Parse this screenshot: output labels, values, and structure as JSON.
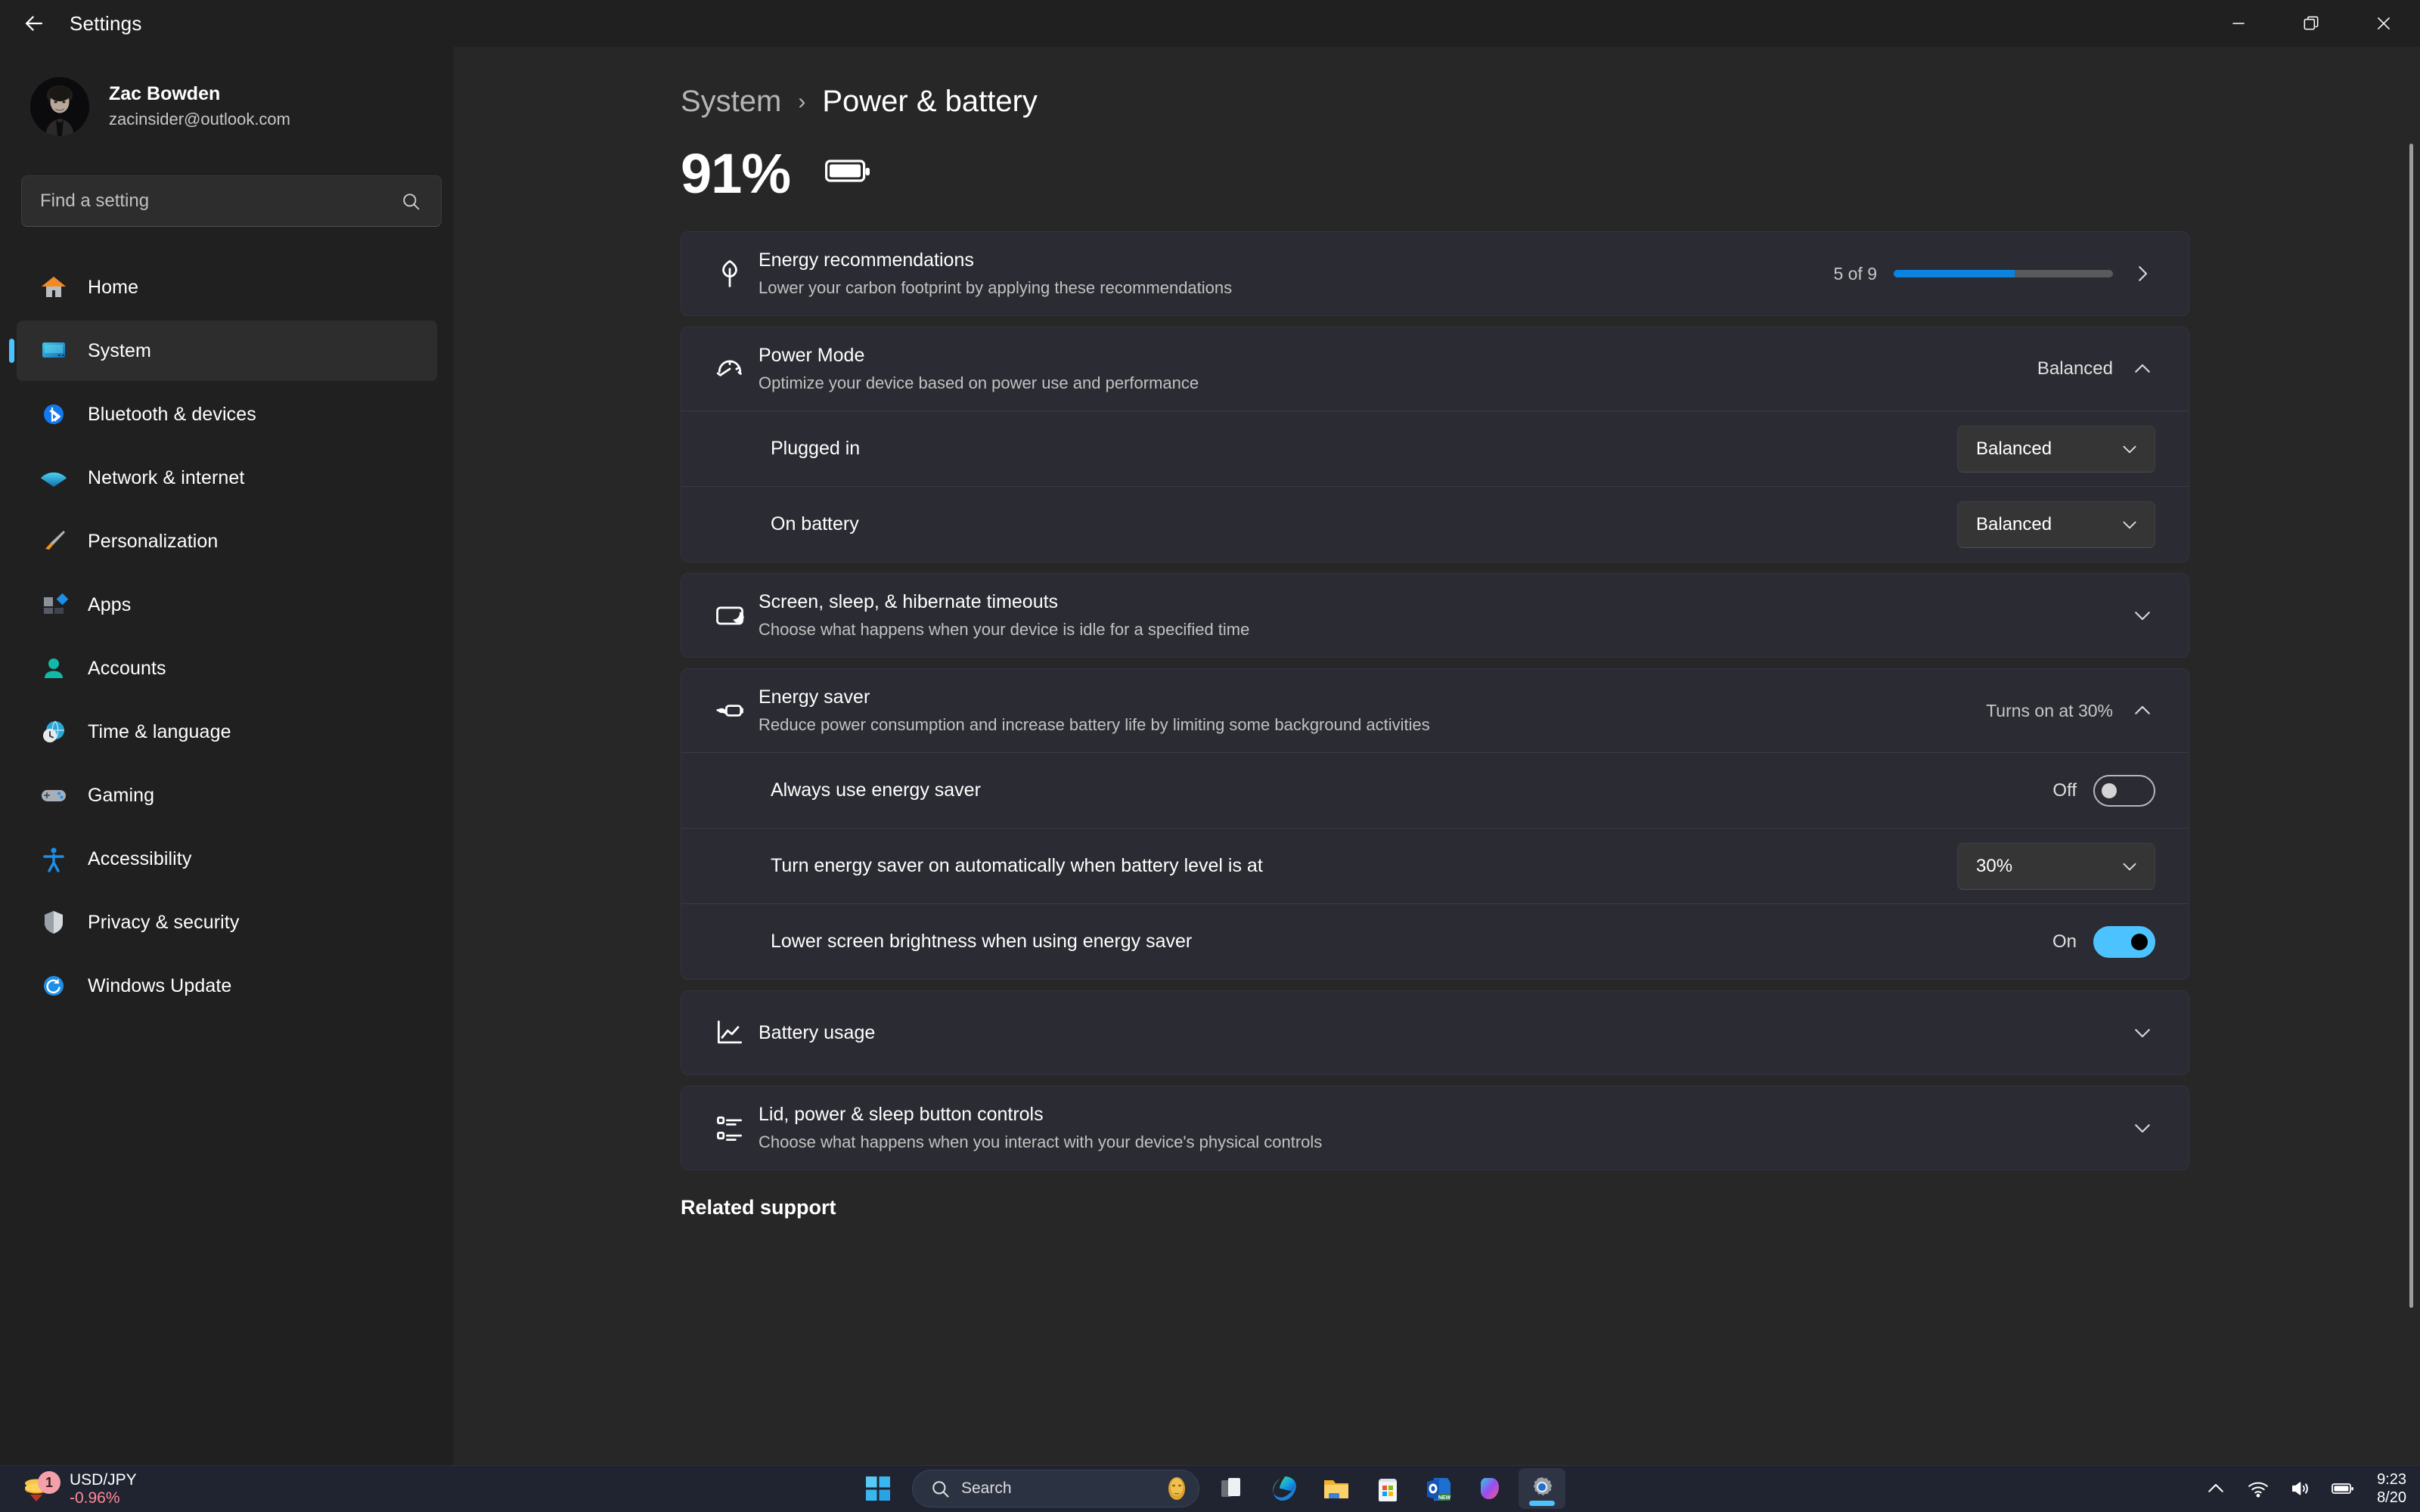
{
  "window": {
    "title": "Settings",
    "back_icon": "back-arrow-icon",
    "minimize_label": "Minimize",
    "restore_label": "Restore",
    "close_label": "Close"
  },
  "sidebar": {
    "profile": {
      "name": "Zac Bowden",
      "email": "zacinsider@outlook.com"
    },
    "search": {
      "placeholder": "Find a setting",
      "icon": "search-icon"
    },
    "items": [
      {
        "label": "Home",
        "icon": "home-icon",
        "active": false
      },
      {
        "label": "System",
        "icon": "system-monitor-icon",
        "active": true
      },
      {
        "label": "Bluetooth & devices",
        "icon": "bluetooth-icon",
        "active": false
      },
      {
        "label": "Network & internet",
        "icon": "wifi-icon",
        "active": false
      },
      {
        "label": "Personalization",
        "icon": "paintbrush-icon",
        "active": false
      },
      {
        "label": "Apps",
        "icon": "apps-icon",
        "active": false
      },
      {
        "label": "Accounts",
        "icon": "person-icon",
        "active": false
      },
      {
        "label": "Time & language",
        "icon": "clock-globe-icon",
        "active": false
      },
      {
        "label": "Gaming",
        "icon": "gamepad-icon",
        "active": false
      },
      {
        "label": "Accessibility",
        "icon": "accessibility-icon",
        "active": false
      },
      {
        "label": "Privacy & security",
        "icon": "shield-icon",
        "active": false
      },
      {
        "label": "Windows Update",
        "icon": "update-refresh-icon",
        "active": false
      }
    ]
  },
  "main": {
    "breadcrumb": {
      "parent": "System",
      "separator": "›",
      "current": "Power & battery"
    },
    "battery": {
      "percent": "91%",
      "icon": "battery-full-icon"
    },
    "energy_recommendations": {
      "title": "Energy recommendations",
      "subtitle": "Lower your carbon footprint by applying these recommendations",
      "count": "5 of 9",
      "progress_percent": 55,
      "icon": "leaf-icon",
      "chevron": "chevron-right-icon"
    },
    "power_mode": {
      "title": "Power Mode",
      "subtitle": "Optimize your device based on power use and performance",
      "value": "Balanced",
      "icon": "gauge-icon",
      "chevron": "chevron-up-icon",
      "rows": [
        {
          "label": "Plugged in",
          "value": "Balanced"
        },
        {
          "label": "On battery",
          "value": "Balanced"
        }
      ]
    },
    "screen_sleep": {
      "title": "Screen, sleep, & hibernate timeouts",
      "subtitle": "Choose what happens when your device is idle for a specified time",
      "icon": "monitor-moon-icon",
      "chevron": "chevron-down-icon"
    },
    "energy_saver": {
      "title": "Energy saver",
      "subtitle": "Reduce power consumption and increase battery life by limiting some background activities",
      "status": "Turns on at 30%",
      "icon": "battery-leaf-icon",
      "chevron": "chevron-up-icon",
      "rows": [
        {
          "label": "Always use energy saver",
          "control": "toggle",
          "state": "Off",
          "on": false
        },
        {
          "label": "Turn energy saver on automatically when battery level is at",
          "control": "combo",
          "value": "30%"
        },
        {
          "label": "Lower screen brightness when using energy saver",
          "control": "toggle",
          "state": "On",
          "on": true
        }
      ]
    },
    "battery_usage": {
      "title": "Battery usage",
      "icon": "chart-line-icon",
      "chevron": "chevron-down-icon"
    },
    "lid_controls": {
      "title": "Lid, power & sleep button controls",
      "subtitle": "Choose what happens when you interact with your device's physical controls",
      "icon": "list-settings-icon",
      "chevron": "chevron-down-icon"
    },
    "related_support": "Related support"
  },
  "taskbar": {
    "widget": {
      "pair": "USD/JPY",
      "change": "-0.96%",
      "badge": "1",
      "icon": "coins-icon"
    },
    "start_icon": "windows-start-icon",
    "search": {
      "placeholder": "Search",
      "icon": "search-icon",
      "mask_icon": "golden-mask-icon"
    },
    "apps": [
      {
        "name": "task-view-icon",
        "active": false
      },
      {
        "name": "edge-icon",
        "active": false
      },
      {
        "name": "file-explorer-icon",
        "active": false
      },
      {
        "name": "microsoft-store-icon",
        "active": false
      },
      {
        "name": "outlook-icon",
        "active": false,
        "badge": "NEW"
      },
      {
        "name": "copilot-icon",
        "active": false
      },
      {
        "name": "settings-icon",
        "active": true
      }
    ],
    "tray": {
      "overflow_icon": "chevron-up-icon",
      "wifi_icon": "wifi-icon",
      "volume_icon": "speaker-icon",
      "battery_icon": "battery-icon",
      "time": "9:23",
      "date": "8/20"
    }
  },
  "colors": {
    "accent": "#4cc2ff",
    "progress": "#0a84e0",
    "card": "#2b2b33",
    "negative": "#ff8a9b"
  }
}
